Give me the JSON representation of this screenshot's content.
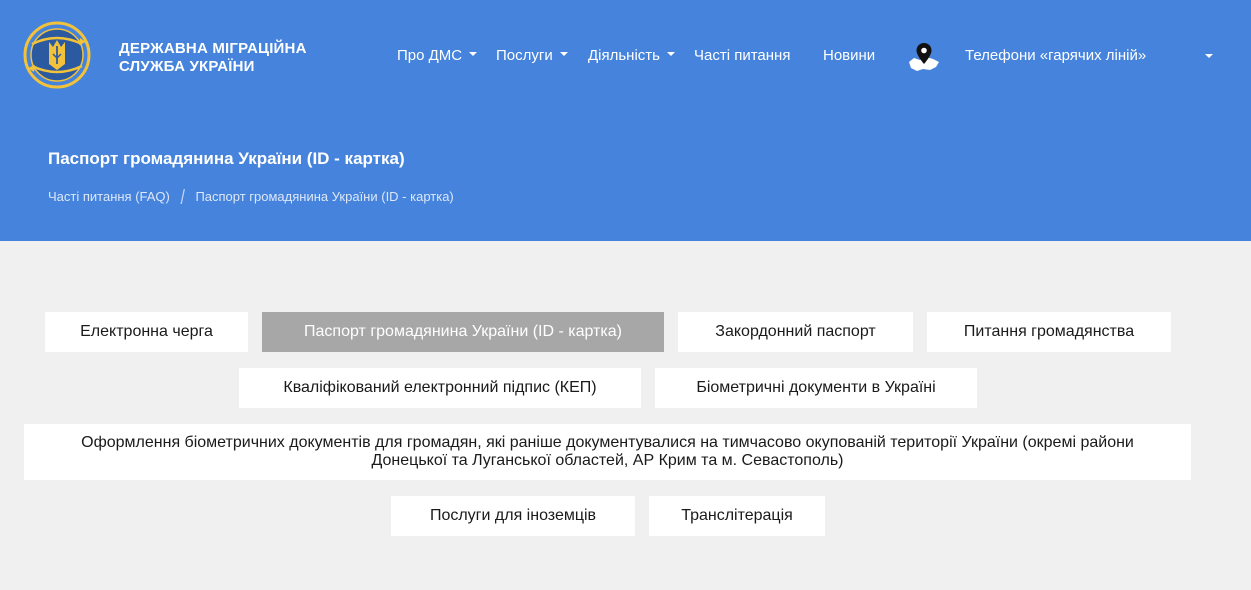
{
  "header": {
    "org_name_line1": "ДЕРЖАВНА МІГРАЦІЙНА",
    "org_name_line2": "СЛУЖБА УКРАЇНИ",
    "logo_icon": "emblem-icon",
    "nav": [
      {
        "label": "Про ДМС",
        "dropdown": true
      },
      {
        "label": "Послуги",
        "dropdown": true
      },
      {
        "label": "Діяльність",
        "dropdown": true
      },
      {
        "label": "Часті питання",
        "dropdown": false
      },
      {
        "label": "Новини",
        "dropdown": false
      }
    ],
    "map_icon": "map-pin-icon",
    "phones_label": "Телефони «гарячих ліній»"
  },
  "hero": {
    "title": "Паспорт громадянина України (ID - картка)",
    "breadcrumb": [
      "Часті питання (FAQ)",
      "Паспорт громадянина України (ID - картка)"
    ],
    "background_color": "#4583dc"
  },
  "categories": [
    {
      "label": "Електронна черга",
      "active": false
    },
    {
      "label": "Паспорт громадянина України (ID - картка)",
      "active": true
    },
    {
      "label": "Закордонний паспорт",
      "active": false
    },
    {
      "label": "Питання громадянства",
      "active": false
    },
    {
      "label": "Кваліфікований електронний підпис (КЕП)",
      "active": false
    },
    {
      "label": "Біометричні документи в Україні",
      "active": false
    },
    {
      "label": "Оформлення біометричних документів для громадян, які раніше документувалися на тимчасово окупованій території України (окремі райони Донецької та Луганської областей, АР Крим та м. Севастополь)",
      "active": false
    },
    {
      "label": "Послуги для іноземців",
      "active": false
    },
    {
      "label": "Транслітерація",
      "active": false
    }
  ]
}
